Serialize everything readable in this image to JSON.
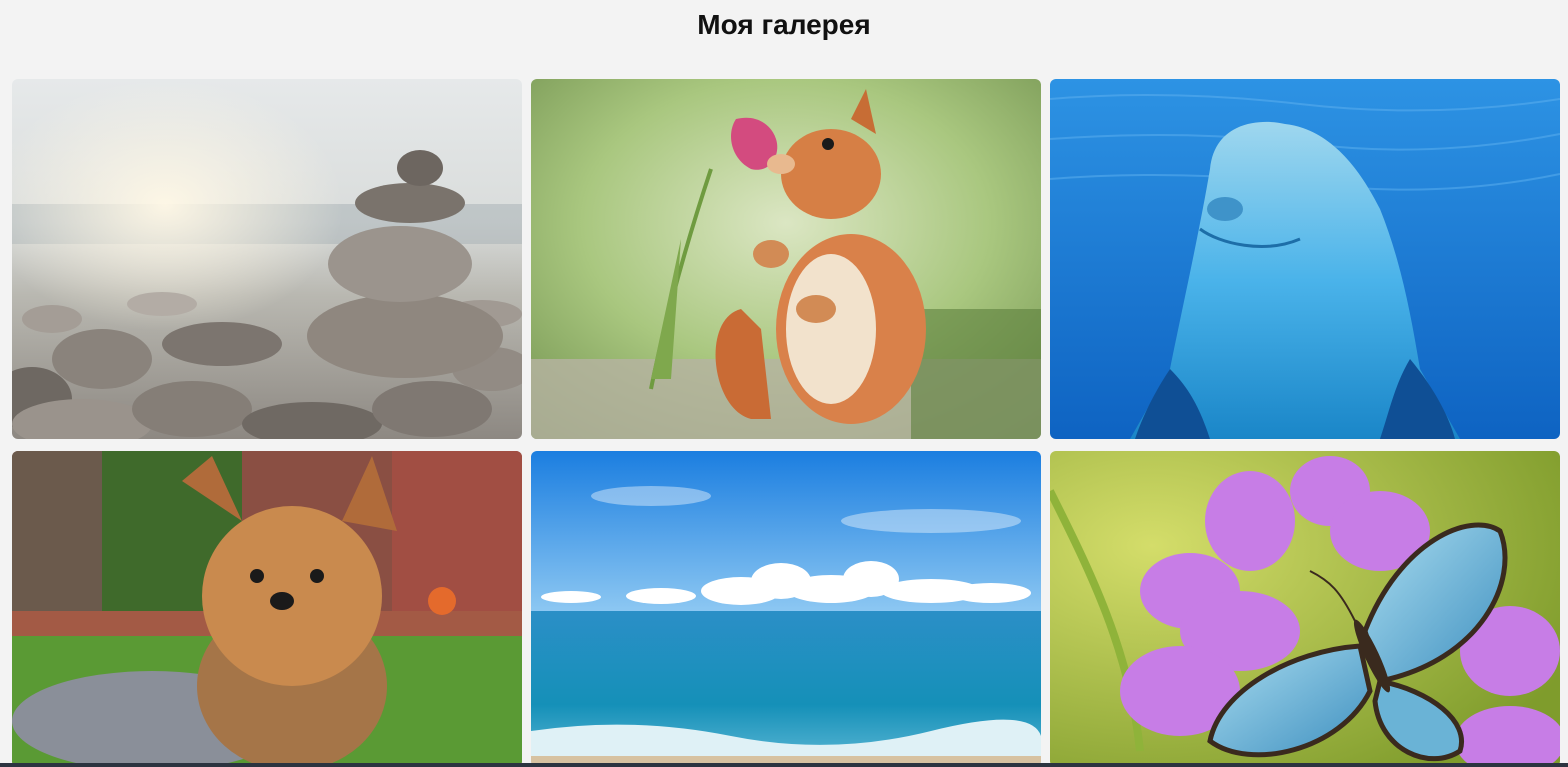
{
  "gallery": {
    "title": "Моя галерея",
    "images": [
      {
        "subject": "stacked-pebbles",
        "palette": [
          "#e9ecee",
          "#9c948c",
          "#5f5a55"
        ]
      },
      {
        "subject": "squirrel-with-tulip",
        "palette": [
          "#a9c77f",
          "#d9814a",
          "#d34b7f"
        ]
      },
      {
        "subject": "dolphin-underwater",
        "palette": [
          "#1a7fd9",
          "#4ab3ea",
          "#0f4f95"
        ]
      },
      {
        "subject": "yorkshire-terrier-on-grass",
        "palette": [
          "#5a9a34",
          "#c98a4e",
          "#8a8f99"
        ]
      },
      {
        "subject": "sea-and-sky",
        "palette": [
          "#1f86e6",
          "#ffffff",
          "#1590b8"
        ]
      },
      {
        "subject": "blue-butterfly-on-orchids",
        "palette": [
          "#b6c93c",
          "#c77de6",
          "#6ab3d6"
        ]
      }
    ]
  }
}
